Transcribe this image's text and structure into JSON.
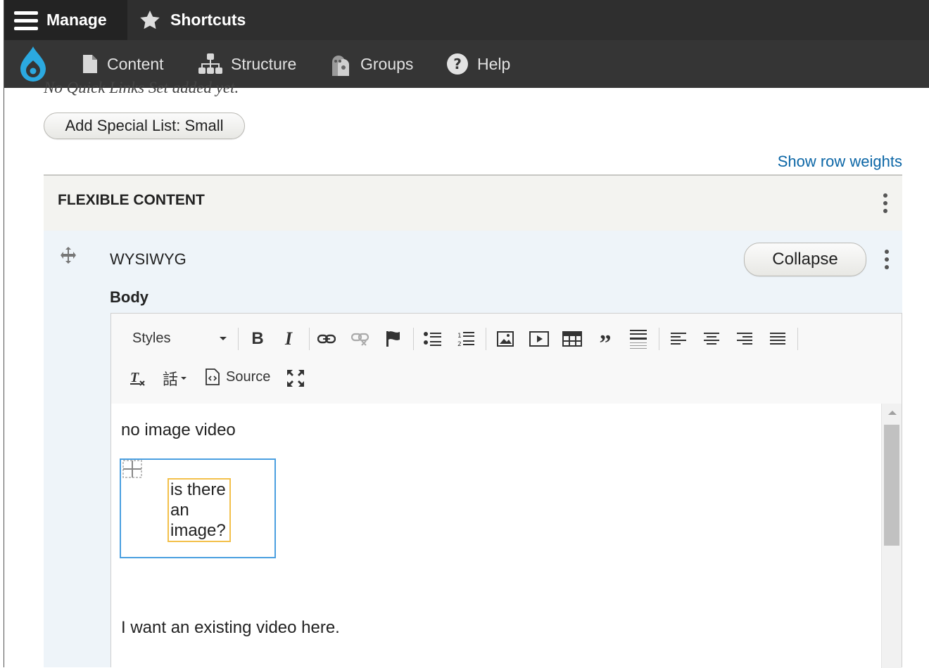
{
  "toolbar": {
    "manage_label": "Manage",
    "shortcuts_label": "Shortcuts"
  },
  "nav": {
    "items": [
      {
        "label": "Content",
        "icon": "file-icon"
      },
      {
        "label": "Structure",
        "icon": "sitemap-icon"
      },
      {
        "label": "Groups",
        "icon": "groups-icon"
      },
      {
        "label": "Help",
        "icon": "help-icon"
      }
    ]
  },
  "page": {
    "quick_links_text": "No Quick Links Set added yet.",
    "add_special_list_label": "Add Special List: Small",
    "show_row_weights_label": "Show row weights",
    "flexible_content_title": "FLEXIBLE CONTENT",
    "paragraph_type": "WYSIWYG",
    "collapse_label": "Collapse",
    "body_label": "Body"
  },
  "editor": {
    "styles_label": "Styles",
    "source_label": "Source",
    "content": {
      "line1": "no image video",
      "caption": "is there an image?",
      "line2": "I want an existing video here."
    }
  },
  "colors": {
    "toolbar_bg": "#2f2f2f",
    "nav_bg": "#353535",
    "link": "#0b66a6",
    "drupal_blue": "#2ba9e0",
    "embed_border": "#4a9fe0",
    "caption_border": "#f3c04b"
  }
}
